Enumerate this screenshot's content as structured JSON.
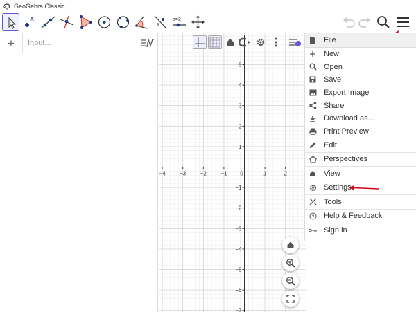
{
  "window": {
    "title": "GeoGebra Classic"
  },
  "toolbar": {
    "tools": [
      {
        "name": "move-tool"
      },
      {
        "name": "point-tool"
      },
      {
        "name": "line-tool"
      },
      {
        "name": "perpendicular-line-tool"
      },
      {
        "name": "polygon-tool"
      },
      {
        "name": "circle-center-point-tool"
      },
      {
        "name": "circle-three-points-tool"
      },
      {
        "name": "angle-tool"
      },
      {
        "name": "reflect-tool"
      },
      {
        "name": "slider-tool",
        "label": "a=2"
      },
      {
        "name": "move-graphics-view-tool"
      }
    ]
  },
  "algebra": {
    "input_placeholder": "Input..."
  },
  "graphics": {
    "x_ticks": [
      "−4",
      "−3",
      "−2",
      "−1",
      "0",
      "1",
      "2"
    ],
    "y_ticks_pos": [
      "5",
      "4",
      "3",
      "2",
      "1"
    ],
    "y_ticks_neg": [
      "−1",
      "−2",
      "−3",
      "−4",
      "−5",
      "−6",
      "−7"
    ]
  },
  "menu": {
    "header": "File",
    "file_items": [
      "New",
      "Open",
      "Save",
      "Export Image",
      "Share",
      "Download as...",
      "Print Preview"
    ],
    "sections": [
      "Edit",
      "Perspectives",
      "View",
      "Settings",
      "Tools",
      "Help & Feedback",
      "Sign in"
    ]
  },
  "colors": {
    "accent": "#6557d2",
    "tool_icon": "#1a3a87",
    "annotation": "#d0021b"
  }
}
